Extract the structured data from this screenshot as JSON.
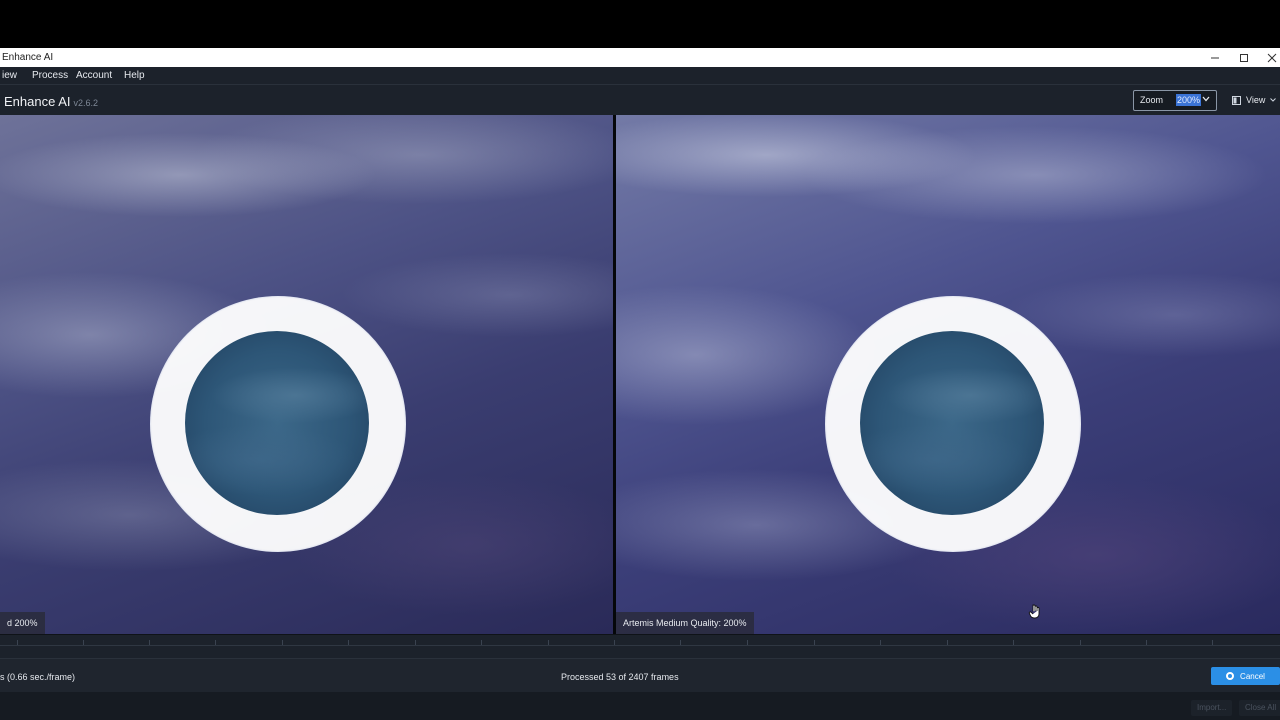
{
  "window": {
    "title": "Enhance AI",
    "controls": [
      "minimize-icon",
      "maximize-icon",
      "close-icon"
    ]
  },
  "menu": {
    "items": [
      "iew",
      "Process",
      "Account",
      "Help"
    ]
  },
  "header": {
    "app_name": "Enhance AI",
    "version": "v2.6.2",
    "zoom_label": "Zoom",
    "zoom_value": "200%",
    "view_label": "View"
  },
  "previews": {
    "left_label": "d 200%",
    "right_label": "Artemis Medium Quality: 200%"
  },
  "status": {
    "speed": "s  (0.66 sec./frame)",
    "progress": "Processed 53 of 2407 frames",
    "cancel_label": "Cancel"
  },
  "bottom": {
    "import_label": "Import...",
    "close_all_label": "Close All"
  },
  "colors": {
    "accent": "#2b8fe6",
    "background": "#1c222b",
    "selection": "#3b74d6"
  }
}
